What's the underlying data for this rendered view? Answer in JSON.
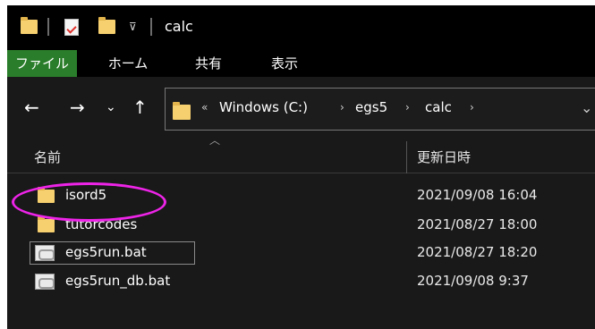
{
  "window": {
    "title": "calc"
  },
  "ribbon": {
    "tabs": [
      "ファイル",
      "ホーム",
      "共有",
      "表示"
    ]
  },
  "address": {
    "overflow": "«",
    "crumbs": [
      "Windows (C:)",
      "egs5",
      "calc"
    ],
    "separator": "›"
  },
  "list": {
    "headers": {
      "name": "名前",
      "date": "更新日時"
    },
    "rows": [
      {
        "icon": "folder-icon",
        "name": "isord5",
        "date": "2021/09/08 16:04"
      },
      {
        "icon": "folder-icon",
        "name": "tutorcodes",
        "date": "2021/08/27 18:00"
      },
      {
        "icon": "batch-file-icon",
        "name": "egs5run.bat",
        "date": "2021/08/27 18:20"
      },
      {
        "icon": "batch-file-icon",
        "name": "egs5run_db.bat",
        "date": "2021/09/08 9:37"
      }
    ]
  },
  "colors": {
    "file_tab": "#2a7d2a",
    "highlight": "#ee24e8",
    "folder": "#f6cf6e"
  }
}
